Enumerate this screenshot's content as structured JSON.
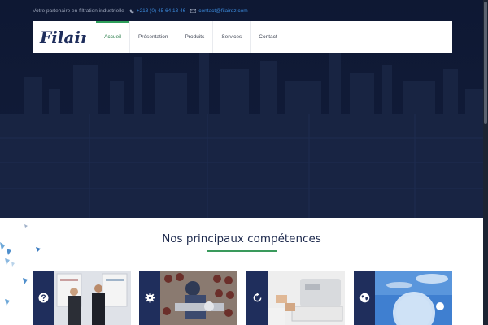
{
  "topbar": {
    "tagline": "Votre partenaire en filtration industrielle",
    "phone": "+213 (0) 45 64 13 46",
    "email": "contact@filairdz.com"
  },
  "logo": {
    "text": "Filair"
  },
  "nav": {
    "items": [
      {
        "label": "Accueil",
        "active": true
      },
      {
        "label": "Présentation",
        "active": false
      },
      {
        "label": "Produits",
        "active": false
      },
      {
        "label": "Services",
        "active": false
      },
      {
        "label": "Contact",
        "active": false
      }
    ]
  },
  "section": {
    "title": "Nos principaux compétences"
  },
  "cards": [
    {
      "icon": "question-icon"
    },
    {
      "icon": "gear-icon"
    },
    {
      "icon": "refresh-icon"
    },
    {
      "icon": "globe-icon"
    }
  ],
  "colors": {
    "hero_bg": "#0e1833",
    "nav_active": "#2a7d4a",
    "accent_rule": "#3a9a5c",
    "card_band": "#1f2e5c",
    "link": "#3a87d8",
    "title": "#1e2a4d"
  }
}
